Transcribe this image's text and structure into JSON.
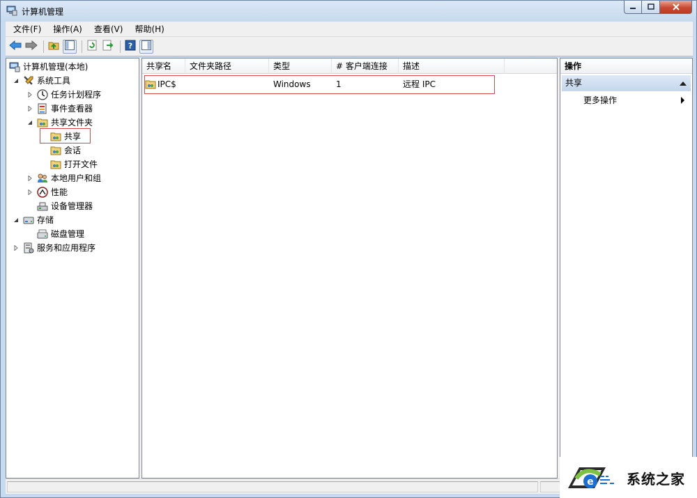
{
  "window": {
    "title": "计算机管理"
  },
  "menubar": {
    "items": [
      {
        "label": "文件(F)"
      },
      {
        "label": "操作(A)"
      },
      {
        "label": "查看(V)"
      },
      {
        "label": "帮助(H)"
      }
    ]
  },
  "tree": {
    "root": "计算机管理(本地)",
    "system_tools": "系统工具",
    "task_scheduler": "任务计划程序",
    "event_viewer": "事件查看器",
    "shared_folders": "共享文件夹",
    "shares": "共享",
    "sessions": "会话",
    "open_files": "打开文件",
    "local_users": "本地用户和组",
    "performance": "性能",
    "device_manager": "设备管理器",
    "storage": "存储",
    "disk_management": "磁盘管理",
    "services_apps": "服务和应用程序"
  },
  "list": {
    "columns": [
      {
        "label": "共享名"
      },
      {
        "label": "文件夹路径"
      },
      {
        "label": "类型"
      },
      {
        "label": "# 客户端连接"
      },
      {
        "label": "描述"
      }
    ],
    "rows": [
      {
        "name": "IPC$",
        "path": "",
        "type": "Windows",
        "clients": "1",
        "description": "远程 IPC"
      }
    ]
  },
  "actions": {
    "title": "操作",
    "section": "共享",
    "more": "更多操作"
  },
  "watermark": {
    "text": "系统之家"
  },
  "colors": {
    "highlight_border": "#d9484f",
    "section_bg": "#c4d6ec"
  }
}
